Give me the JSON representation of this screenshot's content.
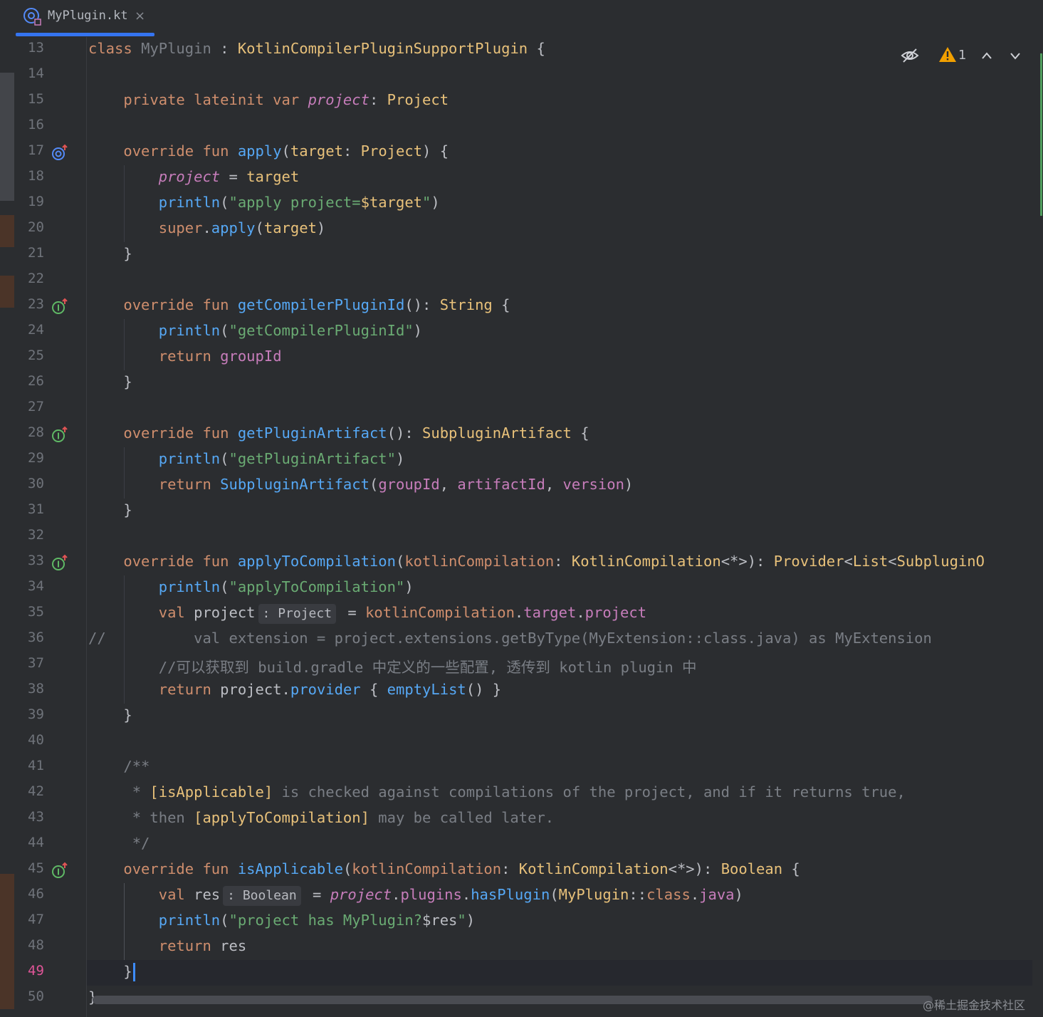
{
  "tab": {
    "filename": "MyPlugin.kt",
    "close": "×"
  },
  "inspection": {
    "warning_count": "1"
  },
  "watermark": "@稀土掘金技术社区",
  "lines": [
    {
      "n": "13",
      "segs": [
        [
          "kw",
          "class "
        ],
        [
          "cm",
          "MyPlugin"
        ],
        [
          "br",
          " : "
        ],
        [
          "ty",
          "KotlinCompilerPluginSupportPlugin"
        ],
        [
          "br",
          " {"
        ]
      ]
    },
    {
      "n": "14",
      "segs": []
    },
    {
      "n": "15",
      "segs": [
        [
          "kw",
          "    private lateinit var "
        ],
        [
          "prop-i",
          "project"
        ],
        [
          "br",
          ": "
        ],
        [
          "ty",
          "Project"
        ]
      ]
    },
    {
      "n": "16",
      "segs": []
    },
    {
      "n": "17",
      "icon": "override-icon",
      "segs": [
        [
          "kw",
          "    override fun "
        ],
        [
          "fn",
          "apply"
        ],
        [
          "br",
          "("
        ],
        [
          "ty",
          "target"
        ],
        [
          "br",
          ": "
        ],
        [
          "ty",
          "Project"
        ],
        [
          "br",
          ") {"
        ]
      ]
    },
    {
      "n": "18",
      "segs": [
        [
          "br",
          "        "
        ],
        [
          "prop-i",
          "project"
        ],
        [
          "br",
          " = "
        ],
        [
          "ty",
          "target"
        ]
      ]
    },
    {
      "n": "19",
      "segs": [
        [
          "fn",
          "        println"
        ],
        [
          "br",
          "("
        ],
        [
          "str",
          "\"apply project="
        ],
        [
          "ty",
          "$target"
        ],
        [
          "str",
          "\""
        ],
        [
          "br",
          ")"
        ]
      ]
    },
    {
      "n": "20",
      "segs": [
        [
          "kw",
          "        super"
        ],
        [
          "br",
          "."
        ],
        [
          "fn",
          "apply"
        ],
        [
          "br",
          "("
        ],
        [
          "ty",
          "target"
        ],
        [
          "br",
          ")"
        ]
      ]
    },
    {
      "n": "21",
      "segs": [
        [
          "br",
          "    }"
        ]
      ]
    },
    {
      "n": "22",
      "segs": []
    },
    {
      "n": "23",
      "icon": "implement-icon",
      "segs": [
        [
          "kw",
          "    override fun "
        ],
        [
          "fn",
          "getCompilerPluginId"
        ],
        [
          "br",
          "(): "
        ],
        [
          "ty",
          "String"
        ],
        [
          "br",
          " {"
        ]
      ]
    },
    {
      "n": "24",
      "segs": [
        [
          "fn",
          "        println"
        ],
        [
          "br",
          "("
        ],
        [
          "str",
          "\"getCompilerPluginId\""
        ],
        [
          "br",
          ")"
        ]
      ]
    },
    {
      "n": "25",
      "segs": [
        [
          "kw",
          "        return "
        ],
        [
          "prop",
          "groupId"
        ]
      ]
    },
    {
      "n": "26",
      "segs": [
        [
          "br",
          "    }"
        ]
      ]
    },
    {
      "n": "27",
      "segs": []
    },
    {
      "n": "28",
      "icon": "implement-icon",
      "segs": [
        [
          "kw",
          "    override fun "
        ],
        [
          "fn",
          "getPluginArtifact"
        ],
        [
          "br",
          "(): "
        ],
        [
          "ty",
          "SubpluginArtifact"
        ],
        [
          "br",
          " {"
        ]
      ]
    },
    {
      "n": "29",
      "segs": [
        [
          "fn",
          "        println"
        ],
        [
          "br",
          "("
        ],
        [
          "str",
          "\"getPluginArtifact\""
        ],
        [
          "br",
          ")"
        ]
      ]
    },
    {
      "n": "30",
      "segs": [
        [
          "kw",
          "        return "
        ],
        [
          "fn",
          "SubpluginArtifact"
        ],
        [
          "br",
          "("
        ],
        [
          "prop",
          "groupId"
        ],
        [
          "br",
          ", "
        ],
        [
          "prop",
          "artifactId"
        ],
        [
          "br",
          ", "
        ],
        [
          "prop",
          "version"
        ],
        [
          "br",
          ")"
        ]
      ]
    },
    {
      "n": "31",
      "segs": [
        [
          "br",
          "    }"
        ]
      ]
    },
    {
      "n": "32",
      "segs": []
    },
    {
      "n": "33",
      "icon": "implement-icon",
      "segs": [
        [
          "kw",
          "    override fun "
        ],
        [
          "fn",
          "applyToCompilation"
        ],
        [
          "br",
          "("
        ],
        [
          "kw",
          "kotlinCompilation"
        ],
        [
          "br",
          ": "
        ],
        [
          "ty",
          "KotlinCompilation"
        ],
        [
          "br",
          "<*>): "
        ],
        [
          "ty",
          "Provider"
        ],
        [
          "br",
          "<"
        ],
        [
          "ty",
          "List"
        ],
        [
          "br",
          "<"
        ],
        [
          "ty",
          "SubpluginO"
        ]
      ]
    },
    {
      "n": "34",
      "segs": [
        [
          "fn",
          "        println"
        ],
        [
          "br",
          "("
        ],
        [
          "str",
          "\"applyToCompilation\""
        ],
        [
          "br",
          ")"
        ]
      ]
    },
    {
      "n": "35",
      "segs": [
        [
          "kw",
          "        val "
        ],
        [
          "br",
          "project"
        ],
        [
          "hint",
          ": Project"
        ],
        [
          "br",
          " = "
        ],
        [
          "kw",
          "kotlinCompilation"
        ],
        [
          "br",
          "."
        ],
        [
          "prop",
          "target"
        ],
        [
          "br",
          "."
        ],
        [
          "prop",
          "project"
        ]
      ]
    },
    {
      "n": "36",
      "segs": [
        [
          "cm",
          "//          val extension = project.extensions.getByType(MyExtension::class.java) as MyExtension"
        ]
      ]
    },
    {
      "n": "37",
      "segs": [
        [
          "cm",
          "        //可以获取到 build.gradle 中定义的一些配置, 透传到 kotlin plugin 中"
        ]
      ]
    },
    {
      "n": "38",
      "segs": [
        [
          "kw",
          "        return "
        ],
        [
          "br",
          "project."
        ],
        [
          "fn",
          "provider"
        ],
        [
          "br",
          " { "
        ],
        [
          "fn",
          "emptyList"
        ],
        [
          "br",
          "() }"
        ]
      ]
    },
    {
      "n": "39",
      "segs": [
        [
          "br",
          "    }"
        ]
      ]
    },
    {
      "n": "40",
      "segs": []
    },
    {
      "n": "41",
      "segs": [
        [
          "cm",
          "    /**"
        ]
      ]
    },
    {
      "n": "42",
      "segs": [
        [
          "cm",
          "     * "
        ],
        [
          "ty",
          "[isApplicable]"
        ],
        [
          "cm",
          " is checked against compilations of the project, and if it returns true,"
        ]
      ]
    },
    {
      "n": "43",
      "segs": [
        [
          "cm",
          "     * then "
        ],
        [
          "ty",
          "[applyToCompilation]"
        ],
        [
          "cm",
          " may be called later."
        ]
      ]
    },
    {
      "n": "44",
      "segs": [
        [
          "cm",
          "     */"
        ]
      ]
    },
    {
      "n": "45",
      "icon": "implement-icon",
      "segs": [
        [
          "kw",
          "    override fun "
        ],
        [
          "fn",
          "isApplicable"
        ],
        [
          "br",
          "("
        ],
        [
          "kw",
          "kotlinCompilation"
        ],
        [
          "br",
          ": "
        ],
        [
          "ty",
          "KotlinCompilation"
        ],
        [
          "br",
          "<*>): "
        ],
        [
          "ty",
          "Boolean"
        ],
        [
          "br",
          " {"
        ]
      ]
    },
    {
      "n": "46",
      "segs": [
        [
          "kw",
          "        val "
        ],
        [
          "br",
          "res"
        ],
        [
          "hint",
          ": Boolean"
        ],
        [
          "br",
          " = "
        ],
        [
          "prop-i",
          "project"
        ],
        [
          "br",
          "."
        ],
        [
          "prop",
          "plugins"
        ],
        [
          "br",
          "."
        ],
        [
          "fn",
          "hasPlugin"
        ],
        [
          "br",
          "("
        ],
        [
          "ty",
          "MyPlugin"
        ],
        [
          "br",
          "::"
        ],
        [
          "kw",
          "class"
        ],
        [
          "br",
          "."
        ],
        [
          "prop",
          "java"
        ],
        [
          "br",
          ")"
        ]
      ]
    },
    {
      "n": "47",
      "segs": [
        [
          "fn",
          "        println"
        ],
        [
          "br",
          "("
        ],
        [
          "str",
          "\"project has MyPlugin?"
        ],
        [
          "br",
          "$res"
        ],
        [
          "str",
          "\""
        ],
        [
          "br",
          ")"
        ]
      ]
    },
    {
      "n": "48",
      "segs": [
        [
          "kw",
          "        return "
        ],
        [
          "br",
          "res"
        ]
      ]
    },
    {
      "n": "49",
      "current": true,
      "segs": [
        [
          "br",
          "    }"
        ]
      ]
    },
    {
      "n": "50",
      "segs": [
        [
          "br",
          "}"
        ]
      ]
    }
  ]
}
